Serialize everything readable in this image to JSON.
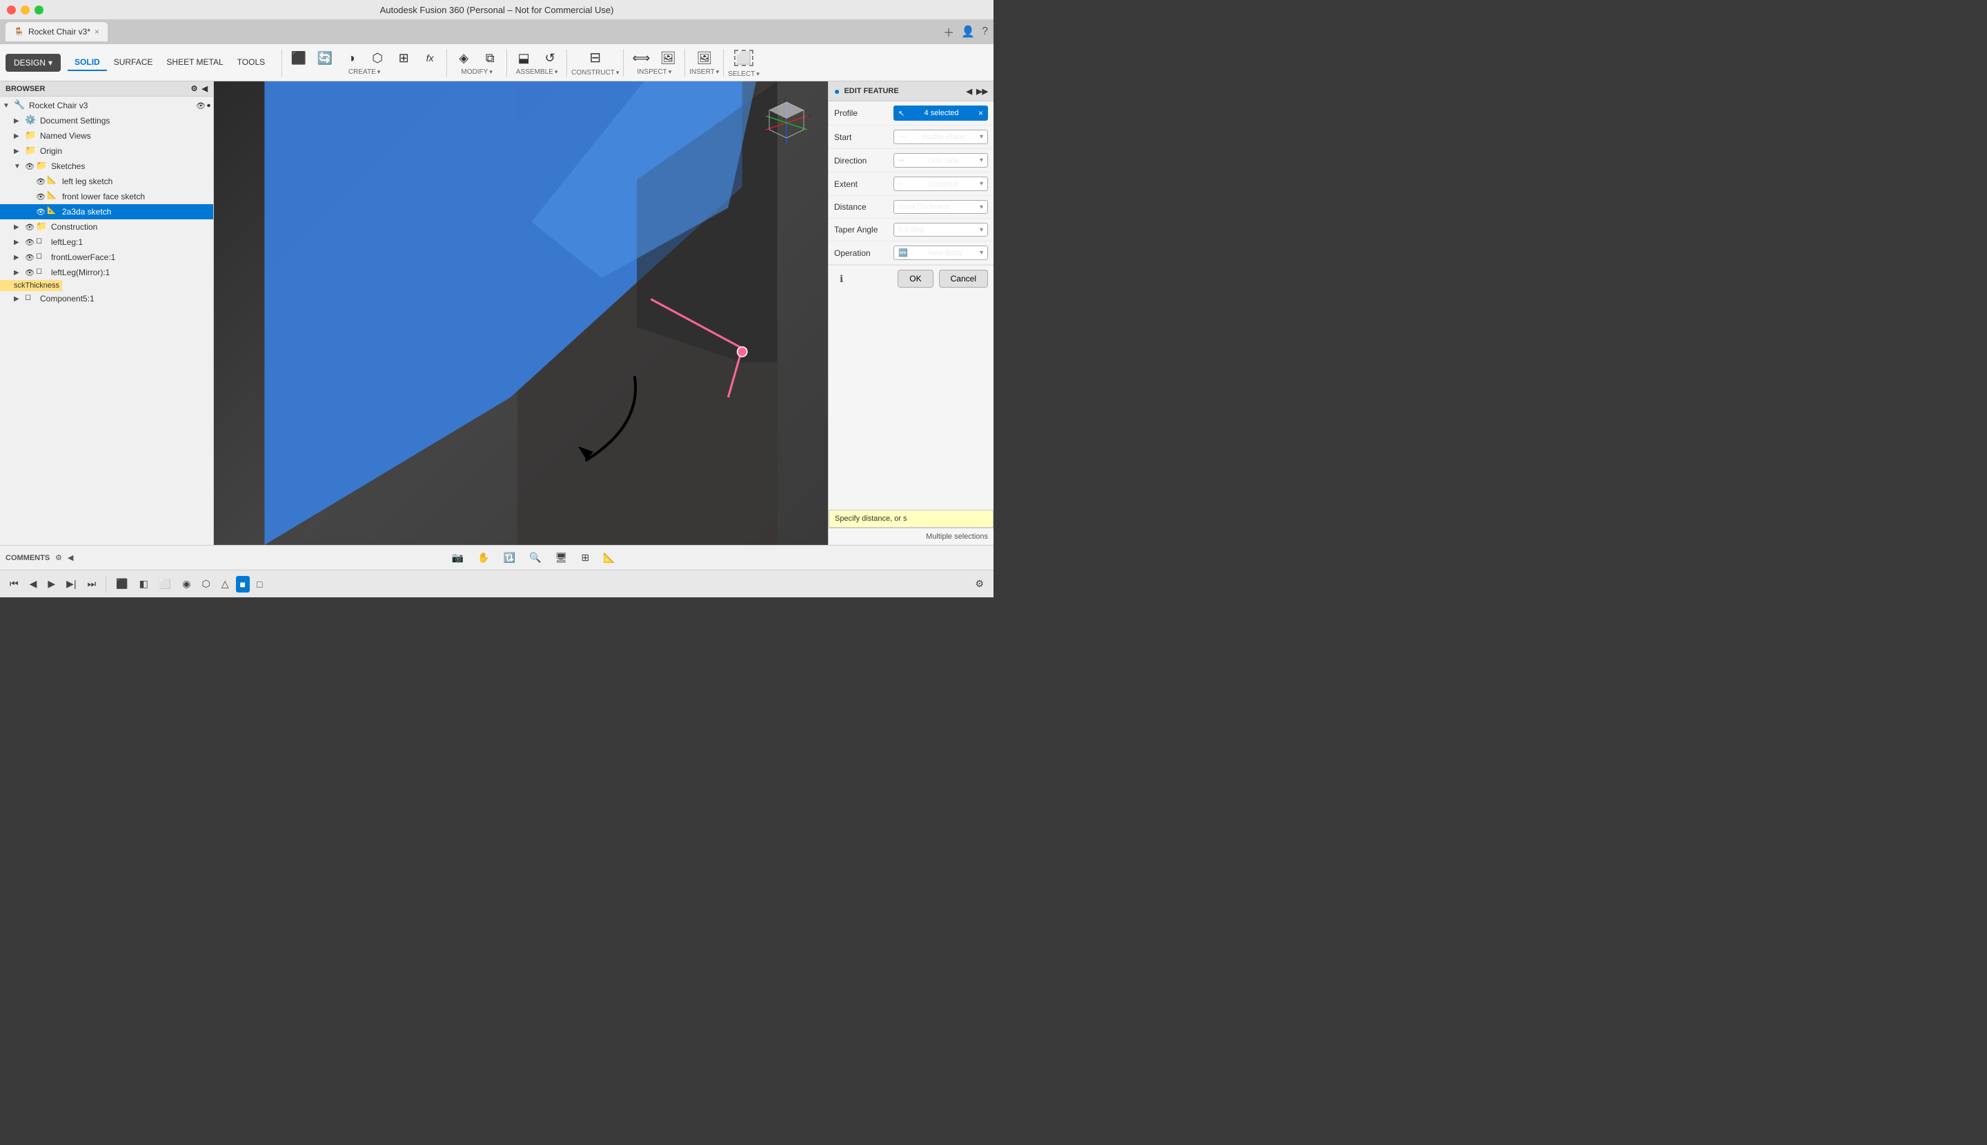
{
  "window": {
    "title": "Autodesk Fusion 360 (Personal – Not for Commercial Use)"
  },
  "tab": {
    "label": "Rocket Chair v3*",
    "close_icon": "×"
  },
  "design_button": "DESIGN",
  "toolbar_tabs": [
    "SOLID",
    "SURFACE",
    "SHEET METAL",
    "TOOLS"
  ],
  "toolbar_active_tab": "SOLID",
  "toolbar_groups": [
    {
      "name": "CREATE",
      "label": "CREATE"
    },
    {
      "name": "MODIFY",
      "label": "MODIFY"
    },
    {
      "name": "ASSEMBLE",
      "label": "ASSEMBLE"
    },
    {
      "name": "CONSTRUCT",
      "label": "CONSTRUCT"
    },
    {
      "name": "INSPECT",
      "label": "INSPECT"
    },
    {
      "name": "INSERT",
      "label": "INSERT"
    },
    {
      "name": "SELECT",
      "label": "SELECT"
    }
  ],
  "browser": {
    "header": "BROWSER",
    "tree": [
      {
        "level": 0,
        "label": "Rocket Chair v3",
        "icon": "🔧",
        "expanded": true,
        "eye": true
      },
      {
        "level": 1,
        "label": "Document Settings",
        "icon": "⚙️",
        "expanded": false
      },
      {
        "level": 1,
        "label": "Named Views",
        "icon": "📁",
        "expanded": false
      },
      {
        "level": 1,
        "label": "Origin",
        "icon": "📁",
        "expanded": false
      },
      {
        "level": 1,
        "label": "Sketches",
        "icon": "📁",
        "expanded": true,
        "eye": true
      },
      {
        "level": 2,
        "label": "left leg sketch",
        "icon": "📄",
        "eye": true
      },
      {
        "level": 2,
        "label": "front lower face sketch",
        "icon": "📄",
        "eye": true
      },
      {
        "level": 2,
        "label": "2a3da sketch",
        "icon": "📄",
        "eye": true,
        "selected": true
      },
      {
        "level": 1,
        "label": "Construction",
        "icon": "📁",
        "expanded": false
      },
      {
        "level": 1,
        "label": "leftLeg:1",
        "icon": "◻",
        "eye": true
      },
      {
        "level": 1,
        "label": "frontLowerFace:1",
        "icon": "◻",
        "eye": true
      },
      {
        "level": 1,
        "label": "leftLeg(Mirror):1",
        "icon": "◻",
        "eye": true
      },
      {
        "level": 1,
        "label": "Component5:1",
        "icon": "◻"
      }
    ]
  },
  "edit_feature": {
    "title": "EDIT FEATURE",
    "fields": [
      {
        "label": "Profile",
        "value": "4 selected",
        "type": "selected",
        "has_clear": true
      },
      {
        "label": "Start",
        "value": "Profile Plane",
        "type": "dropdown"
      },
      {
        "label": "Direction",
        "value": "One Side",
        "type": "dropdown"
      },
      {
        "label": "Extent",
        "value": "Distance",
        "type": "dropdown"
      },
      {
        "label": "Distance",
        "value": "stockThickness",
        "type": "dropdown"
      },
      {
        "label": "Taper Angle",
        "value": "0.0 deg",
        "type": "dropdown"
      },
      {
        "label": "Operation",
        "value": "New Body",
        "type": "dropdown",
        "has_icon": true
      }
    ],
    "ok_label": "OK",
    "cancel_label": "Cancel"
  },
  "statusbar": {
    "comments_label": "COMMENTS",
    "tooltip": "Specify distance, or s",
    "multiple_sel": "Multiple selections"
  },
  "bottom_toolbar_btns": [
    "⏮",
    "◀",
    "▶▌",
    "▶",
    "⏭"
  ],
  "hover_tag": "sckThickness",
  "component_tag": "Component5:1"
}
